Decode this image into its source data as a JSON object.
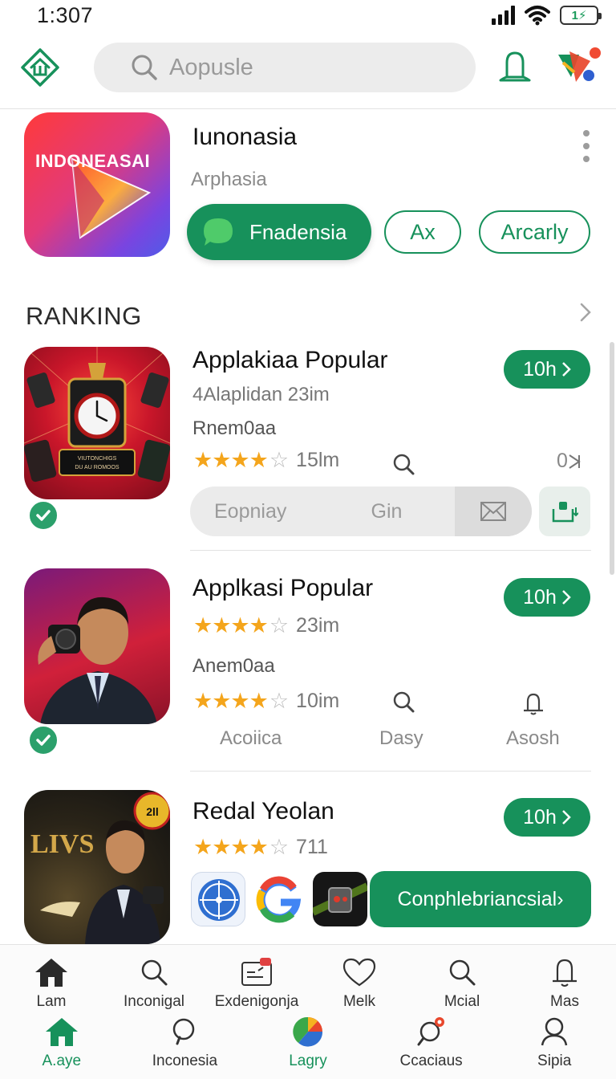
{
  "status_bar": {
    "time": "1:307",
    "battery_text": "1⚡"
  },
  "header": {
    "search_placeholder": "Aopusle"
  },
  "featured": {
    "icon_text": "INDONEASAI",
    "title": "Iunonasia",
    "subtitle": "Arphasia",
    "primary_button": "Fnadensia",
    "outline_buttons": [
      "Ax",
      "Arcarly"
    ]
  },
  "ranking": {
    "title": "RANKING",
    "items": [
      {
        "title": "Applakiaa Popular",
        "meta": "4Alaplidan  23im",
        "tagline": "Rnem0aa",
        "rating": 4.5,
        "stars_text": "★★★★",
        "count": "15lm",
        "time": "10h",
        "trailing": "0",
        "action_label_1": "Eopniay",
        "action_label_2": "Gin",
        "icon_caption": "VIUTONCHIGS\nDU AU ROMOOS"
      },
      {
        "title": "Applkasi Popular",
        "rating": 4.5,
        "count": "23im",
        "tagline": "Anem0aa",
        "rating_2": 4.5,
        "count_2": "10im",
        "time": "10h",
        "mini_labels": [
          "Acoiica",
          "Dasy",
          "Asosh"
        ]
      },
      {
        "title": "Redal Yeolan",
        "rating": 4.5,
        "count": "711",
        "time": "10h",
        "icon_text": "LIVS",
        "badge_text": "2ll",
        "cta": "Conphlebriancsial›"
      }
    ]
  },
  "nav": {
    "row1": [
      "Lam",
      "Inconigal",
      "Exdenigonja",
      "Melk",
      "Mcial",
      "Mas"
    ],
    "row2": [
      "A.aye",
      "Inconesia",
      "Lagry",
      "Ccaciaus",
      "Sipia"
    ],
    "active_row2": 0
  },
  "colors": {
    "accent": "#17915b",
    "star": "#f4a51c"
  }
}
